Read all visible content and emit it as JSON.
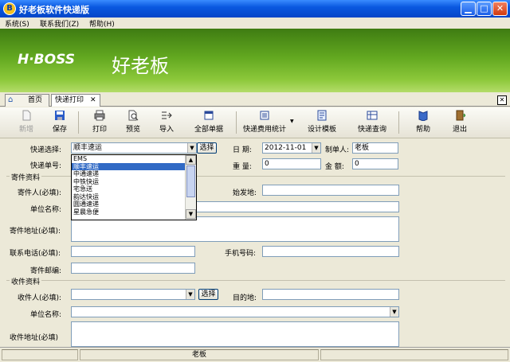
{
  "window": {
    "title": "好老板软件快递版",
    "icon": "app-icon"
  },
  "menu": [
    "系统(S)",
    "联系我们(Z)",
    "帮助(H)"
  ],
  "banner": {
    "logo": "H·BOSS",
    "brand": "好老板"
  },
  "tabs": {
    "home": "首页",
    "active": "快递打印"
  },
  "toolbar": {
    "new": "新增",
    "save": "保存",
    "print": "打印",
    "preview": "预览",
    "import": "导入",
    "all_orders": "全部单据",
    "fee_stats": "快递费用统计",
    "design": "设计模板",
    "query": "快递查询",
    "help": "帮助",
    "exit": "退出"
  },
  "form": {
    "courier_label": "快递选择:",
    "courier_value": "顺丰速运",
    "select_btn": "选择",
    "date_label": "日 期:",
    "date_value": "2012-11-01",
    "maker_label": "制单人:",
    "maker_value": "老板",
    "tracking_label": "快递单号:",
    "weight_label": "重 量:",
    "weight_value": "0",
    "amount_label": "金 额:",
    "amount_value": "0",
    "sender_group": "寄件资料",
    "sender_label": "寄件人(必填):",
    "origin_label": "始发地:",
    "sender_company_label": "单位名称:",
    "sender_address_label": "寄件地址(必填):",
    "phone_label": "联系电话(必填):",
    "mobile_label": "手机号码:",
    "postcode_label": "寄件邮编:",
    "receiver_group": "收件资料",
    "receiver_label": "收件人(必填):",
    "receiver_select": "选择",
    "dest_label": "目的地:",
    "receiver_company_label": "单位名称:",
    "receiver_address_label": "收件地址(必填)"
  },
  "dropdown_options": [
    "EMS",
    "顺丰速运",
    "中通速递",
    "中铁快运",
    "宅急送",
    "韵达快运",
    "圆通速递",
    "星晨急便"
  ],
  "dropdown_selected": 1,
  "status": {
    "user": "老板"
  }
}
